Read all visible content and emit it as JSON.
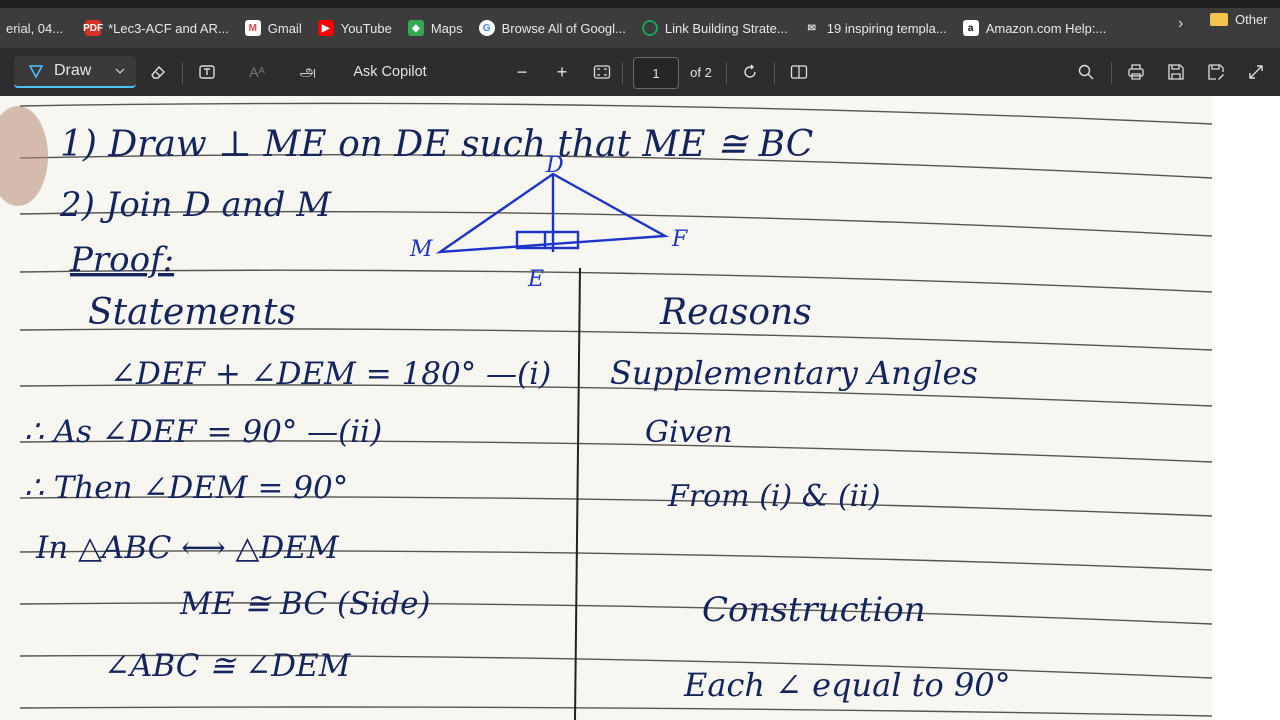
{
  "bookmarks": [
    {
      "label": "erial, 04...",
      "icon": "generic-icon",
      "color": "#444"
    },
    {
      "label": "*Lec3-ACF and AR...",
      "icon": "pdf-icon",
      "color": "#d93025"
    },
    {
      "label": "Gmail",
      "icon": "gmail-icon",
      "color": "#ea4335"
    },
    {
      "label": "YouTube",
      "icon": "youtube-icon",
      "color": "#ff0000"
    },
    {
      "label": "Maps",
      "icon": "maps-icon",
      "color": "#34a853"
    },
    {
      "label": "Browse All of Googl...",
      "icon": "google-icon",
      "color": "#4285f4"
    },
    {
      "label": "Link Building Strate...",
      "icon": "circle-icon",
      "color": "#1aa260"
    },
    {
      "label": "19 inspiring templa...",
      "icon": "mail-icon",
      "color": "#555"
    },
    {
      "label": "Amazon.com Help:...",
      "icon": "amazon-icon",
      "color": "#ff9900"
    }
  ],
  "bookmarks_more_label": "Other",
  "toolbar": {
    "draw_label": "Draw",
    "ask_copilot_label": "Ask Copilot",
    "text_lang_glyph": "அ",
    "zoom_out": "−",
    "zoom_in": "+",
    "page_current": "1",
    "page_total": "of 2"
  },
  "notes": {
    "line1": "1) Draw ⊥ ME on DE such that ME ≅ BC",
    "line2": "2) Join D and M",
    "proof_heading": "Proof:",
    "statements_heading": "Statements",
    "reasons_heading": "Reasons",
    "rows": [
      {
        "statement": "∠DEF + ∠DEM = 180° —(i)",
        "reason": "Supplementary Angles"
      },
      {
        "statement": "∴ As ∠DEF = 90° —(ii)",
        "reason": "Given"
      },
      {
        "statement": "∴ Then ∠DEM = 90°",
        "reason": "From (i) & (ii)"
      },
      {
        "statement": "In △ABC ⟷ △DEM",
        "reason": ""
      },
      {
        "statement": "ME ≅ BC (Side)",
        "reason": "Construction"
      },
      {
        "statement": "∠ABC ≅ ∠DEM",
        "reason": "Each ∠ equal to 90°"
      }
    ],
    "diagram_labels": {
      "top": "D",
      "left": "M",
      "right": "F",
      "bottom": "E"
    }
  },
  "colors": {
    "ink": "#14245e",
    "pen": "#1d34c8",
    "paper": "#f7f6f0",
    "accent": "#4cc2ff"
  }
}
